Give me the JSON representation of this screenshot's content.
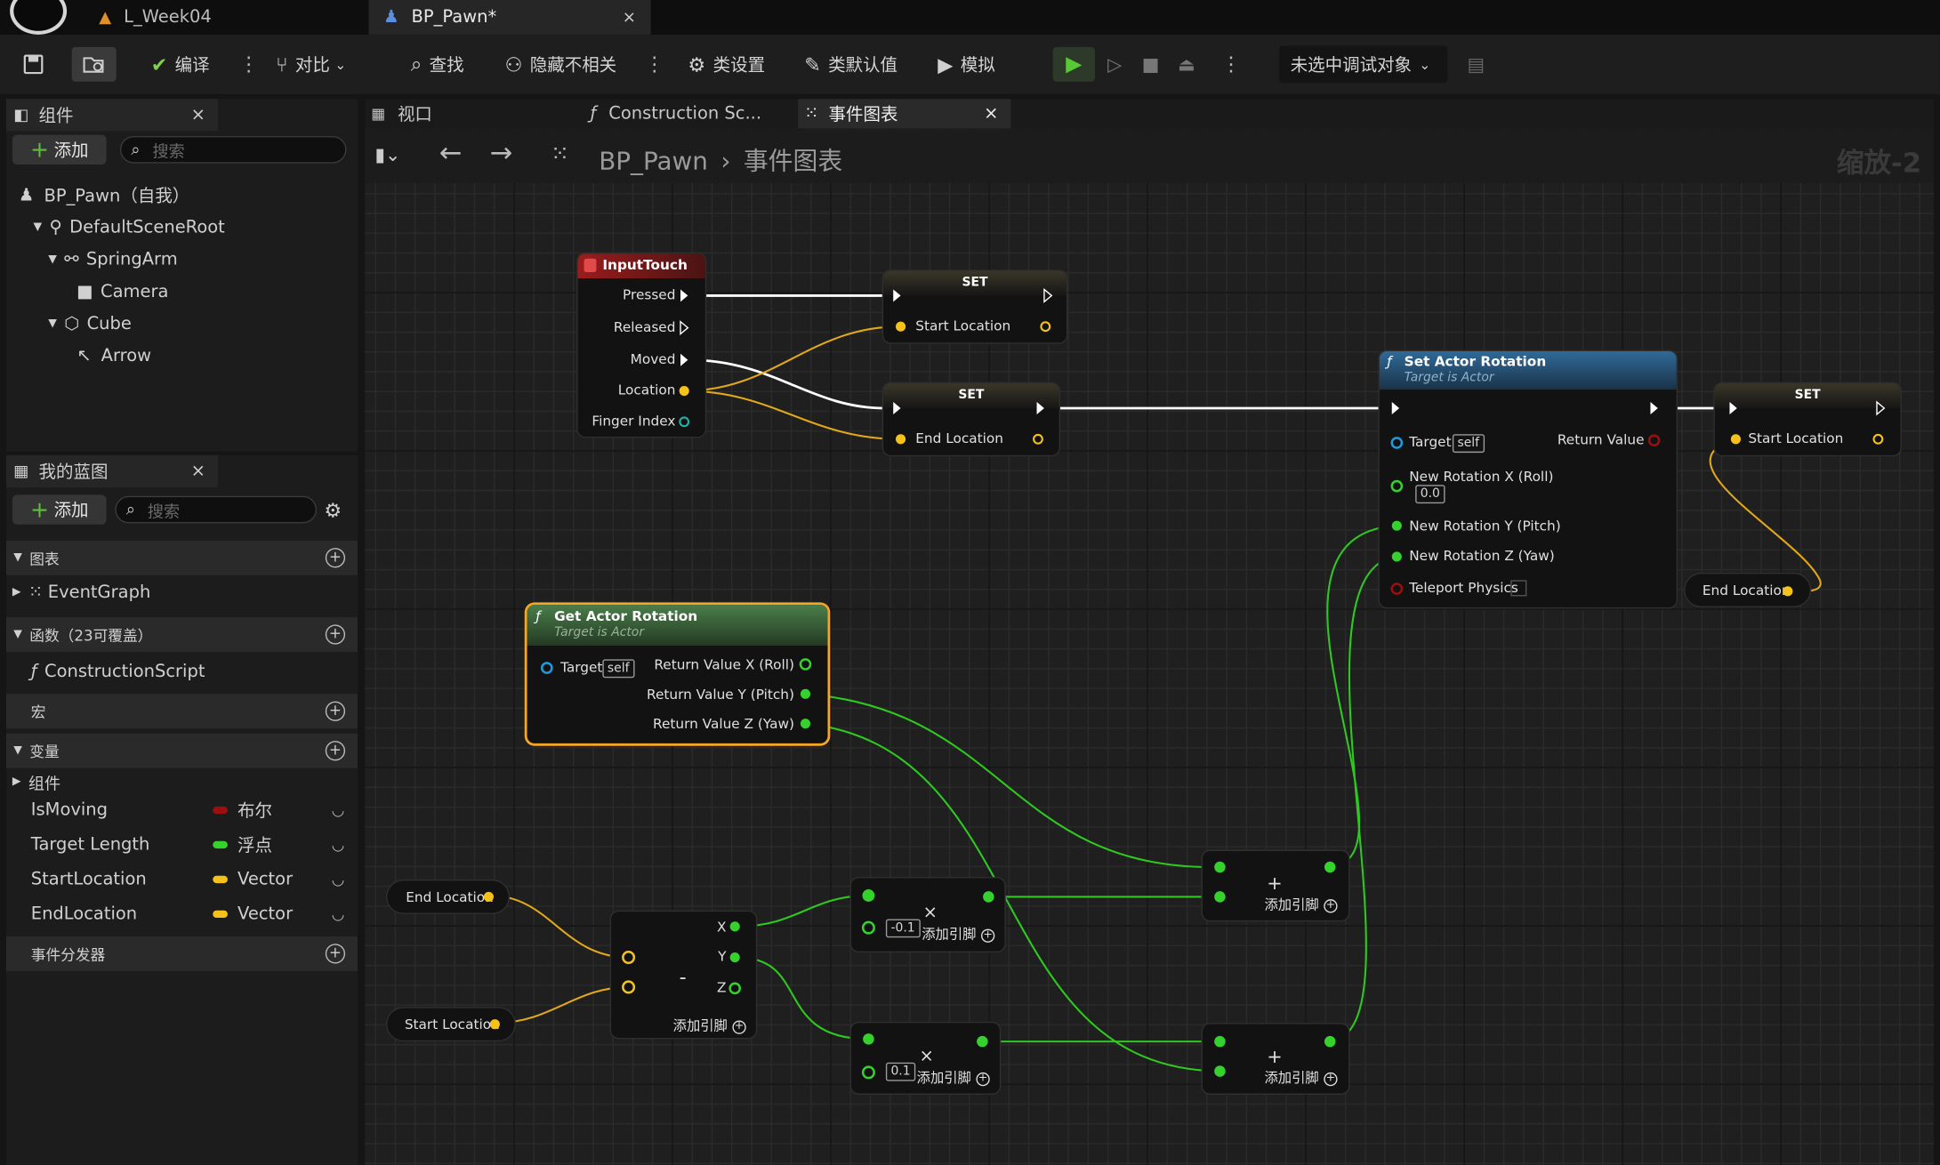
{
  "titlebar": {
    "tabs": [
      {
        "label": "L_Week04",
        "icon": "level-icon"
      },
      {
        "label": "BP_Pawn*",
        "icon": "pawn-icon",
        "close": "×"
      }
    ]
  },
  "toolbar": {
    "compile": "编译",
    "diff": "对比",
    "find": "查找",
    "hide_unrelated": "隐藏不相关",
    "class_settings": "类设置",
    "class_defaults": "类默认值",
    "simulate": "模拟",
    "debug_target": "未选中调试对象"
  },
  "tabs": {
    "components": "组件",
    "viewport": "视口",
    "construction": "Construction Sc...",
    "event_graph": "事件图表",
    "close": "×"
  },
  "components_panel": {
    "add": "添加",
    "search_placeholder": "搜索",
    "tree": [
      "BP_Pawn（自我）",
      "DefaultSceneRoot",
      "SpringArm",
      "Camera",
      "Cube",
      "Arrow"
    ]
  },
  "my_blueprint": {
    "title": "我的蓝图",
    "close": "×",
    "add": "添加",
    "search_placeholder": "搜索",
    "sections": {
      "graphs": "图表",
      "event_graph": "EventGraph",
      "functions": "函数（23可覆盖）",
      "construction_script": "ConstructionScript",
      "macros": "宏",
      "variables": "变量",
      "components": "组件",
      "dispatchers": "事件分发器"
    },
    "variables": [
      {
        "name": "IsMoving",
        "type": "布尔",
        "color": "#9b0f0f"
      },
      {
        "name": "Target Length",
        "type": "浮点",
        "color": "#35d12c"
      },
      {
        "name": "StartLocation",
        "type": "Vector",
        "color": "#f5c21b"
      },
      {
        "name": "EndLocation",
        "type": "Vector",
        "color": "#f5c21b"
      }
    ]
  },
  "graph": {
    "breadcrumb_root": "BP_Pawn",
    "breadcrumb_sep": "›",
    "breadcrumb_current": "事件图表",
    "zoom": "缩放-2",
    "nodes": {
      "input_touch": {
        "title": "InputTouch",
        "pins": [
          "Pressed",
          "Released",
          "Moved",
          "Location",
          "Finger Index"
        ]
      },
      "set1": {
        "title": "SET",
        "pin": "Start Location"
      },
      "set2": {
        "title": "SET",
        "pin": "End Location"
      },
      "set_actor_rotation": {
        "title": "Set Actor Rotation",
        "subtitle": "Target is Actor",
        "target": "Target",
        "self": "self",
        "return_value": "Return Value",
        "roll": "New Rotation X (Roll)",
        "roll_value": "0.0",
        "pitch": "New Rotation Y (Pitch)",
        "yaw": "New Rotation Z (Yaw)",
        "teleport": "Teleport Physics"
      },
      "set3": {
        "title": "SET",
        "pin": "Start Location"
      },
      "end_location_get_right": "End Location",
      "get_actor_rotation": {
        "title": "Get Actor Rotation",
        "subtitle": "Target is Actor",
        "target": "Target",
        "self": "self",
        "rx": "Return Value X (Roll)",
        "ry": "Return Value Y (Pitch)",
        "rz": "Return Value Z (Yaw)"
      },
      "end_location_get": "End Location",
      "start_location_get": "Start Location",
      "subtract": {
        "symbol": "-",
        "x": "X",
        "y": "Y",
        "z": "Z",
        "add_pin": "添加引脚"
      },
      "mult1": {
        "symbol": "×",
        "value": "-0.1",
        "add_pin": "添加引脚"
      },
      "mult2": {
        "symbol": "×",
        "value": "0.1",
        "add_pin": "添加引脚"
      },
      "add1": {
        "symbol": "+",
        "add_pin": "添加引脚"
      },
      "add2": {
        "symbol": "+",
        "add_pin": "添加引脚"
      }
    }
  },
  "colors": {
    "exec": "#ffffff",
    "vector": "#f5c21b",
    "float": "#35d12c",
    "object": "#1e9bdc",
    "bool": "#9b0f0f",
    "event_header": "#8f1d1d",
    "function_header": "#2d5f8a",
    "pure_header": "#3f6b3f",
    "selection": "#f5a623"
  }
}
